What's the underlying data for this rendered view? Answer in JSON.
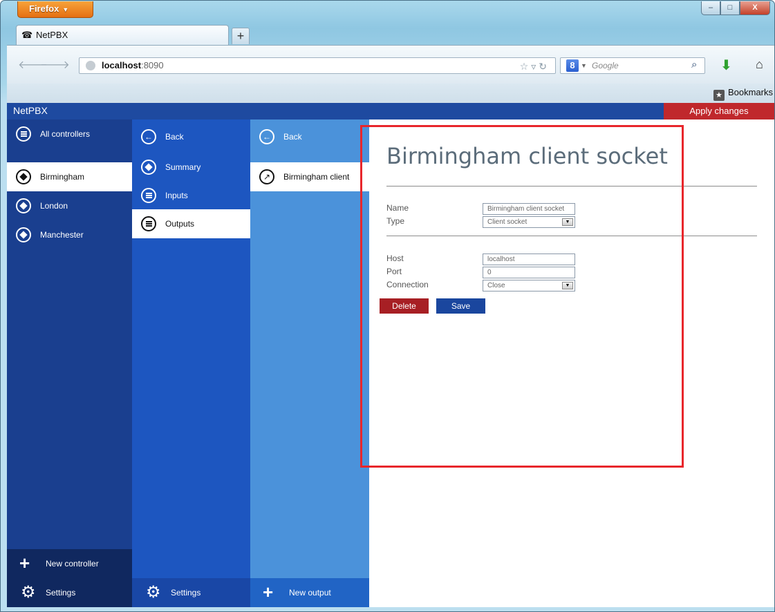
{
  "browser": {
    "menu_label": "Firefox",
    "tab_title": "NetPBX",
    "new_tab": "+",
    "url_host": "localhost",
    "url_rest": ":8090",
    "search_placeholder": "Google",
    "bookmarks_label": "Bookmarks",
    "window_buttons": {
      "minimize": "–",
      "maximize": "□",
      "close": "X"
    }
  },
  "app": {
    "title": "NetPBX",
    "apply_label": "Apply changes"
  },
  "col1": {
    "header": "All controllers",
    "items": [
      {
        "label": "Birmingham",
        "selected": true
      },
      {
        "label": "London"
      },
      {
        "label": "Manchester"
      }
    ],
    "new_label": "New controller",
    "settings_label": "Settings"
  },
  "col2": {
    "back_label": "Back",
    "items": [
      {
        "label": "Summary"
      },
      {
        "label": "Inputs"
      },
      {
        "label": "Outputs",
        "selected": true
      }
    ],
    "settings_label": "Settings"
  },
  "col3": {
    "back_label": "Back",
    "item_label": "Birmingham client",
    "new_label": "New output"
  },
  "form": {
    "title": "Birmingham client socket",
    "name_label": "Name",
    "name_value": "Birmingham client socket",
    "type_label": "Type",
    "type_value": "Client socket",
    "host_label": "Host",
    "host_value": "localhost",
    "port_label": "Port",
    "port_value": "0",
    "connection_label": "Connection",
    "connection_value": "Close",
    "delete_label": "Delete",
    "save_label": "Save"
  },
  "colors": {
    "header_blue": "#1e4aa0",
    "col1_blue": "#1a3f8f",
    "col2_blue": "#1d56c0",
    "col3_blue": "#4b92da",
    "apply_red": "#c0282c",
    "highlight_red": "#e8262b"
  }
}
